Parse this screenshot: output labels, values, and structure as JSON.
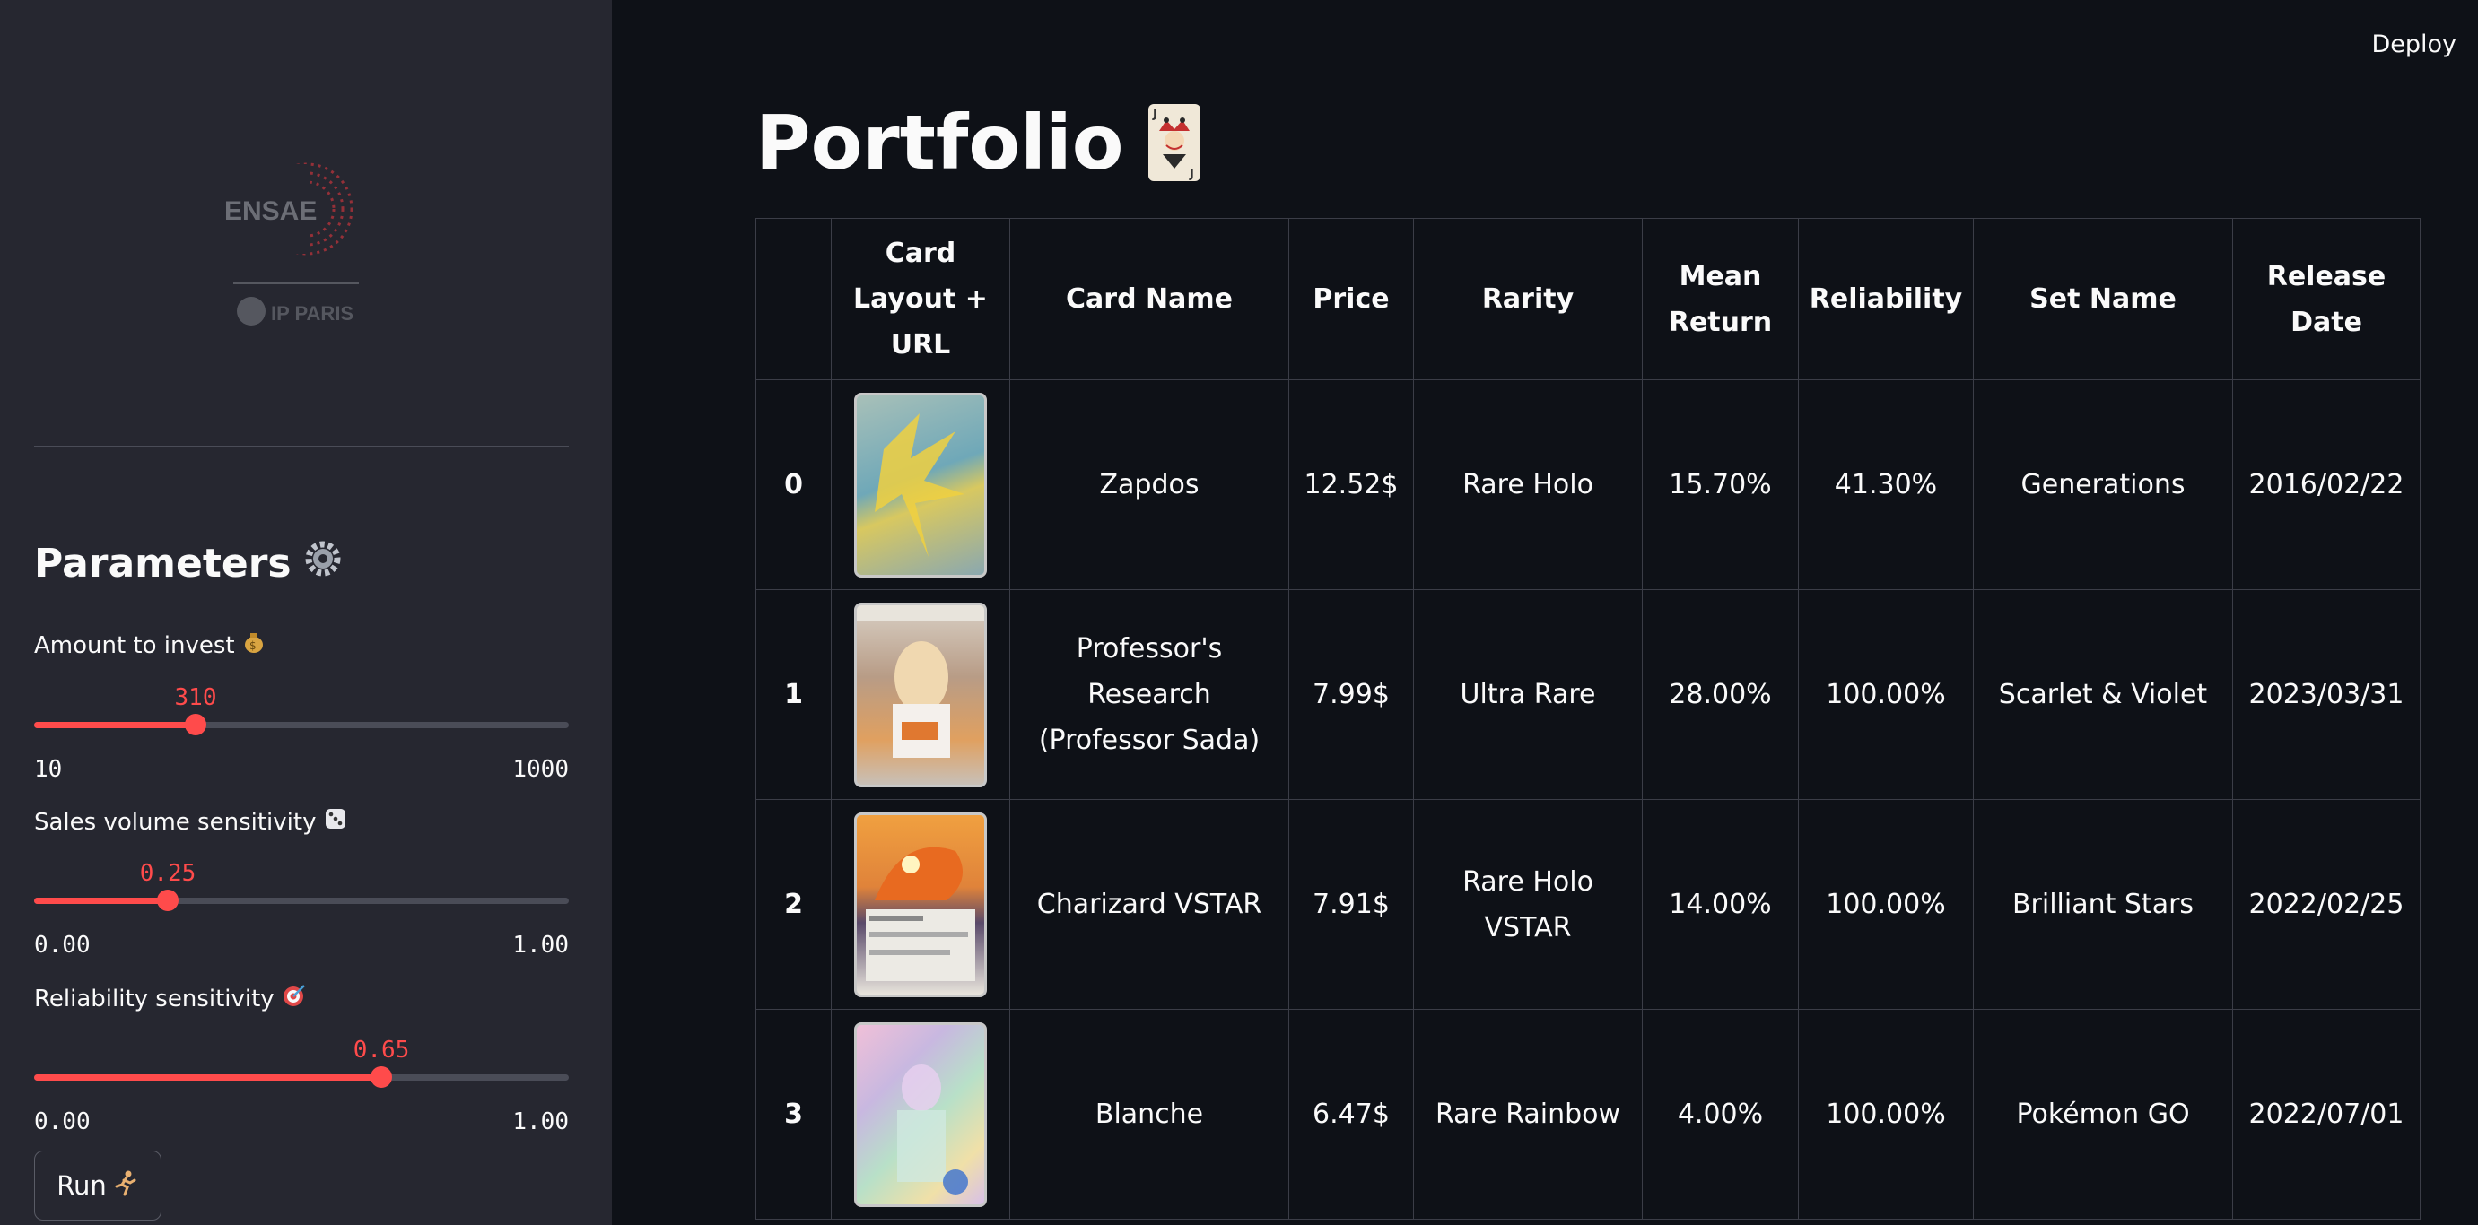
{
  "header": {
    "deploy_label": "Deploy"
  },
  "sidebar": {
    "logo": {
      "text_top": "ENSAE",
      "text_bottom": "IP PARIS"
    },
    "params_title": "Parameters",
    "params_icon": "gear-icon",
    "sliders": [
      {
        "label": "Amount to invest",
        "icon": "money-bag-icon",
        "value_text": "310",
        "min_text": "10",
        "max_text": "1000",
        "fraction": 0.303
      },
      {
        "label": "Sales volume sensitivity",
        "icon": "dice-icon",
        "value_text": "0.25",
        "min_text": "0.00",
        "max_text": "1.00",
        "fraction": 0.25
      },
      {
        "label": "Reliability sensitivity",
        "icon": "target-icon",
        "value_text": "0.65",
        "min_text": "0.00",
        "max_text": "1.00",
        "fraction": 0.65
      }
    ],
    "run_label": "Run",
    "run_icon": "runner-icon"
  },
  "main": {
    "title": "Portfolio",
    "title_icon": "joker-card-icon",
    "table": {
      "headers": [
        "",
        "Card Layout + URL",
        "Card Name",
        "Price",
        "Rarity",
        "Mean Return",
        "Reliability",
        "Set Name",
        "Release Date"
      ],
      "rows": [
        {
          "index": "0",
          "card_name": "Zapdos",
          "price": "12.52$",
          "rarity": "Rare Holo",
          "mean_return": "15.70%",
          "reliability": "41.30%",
          "set_name": "Generations",
          "release_date": "2016/02/22",
          "card_color": "#6fa8b8"
        },
        {
          "index": "1",
          "card_name": "Professor's Research (Professor Sada)",
          "price": "7.99$",
          "rarity": "Ultra Rare",
          "mean_return": "28.00%",
          "reliability": "100.00%",
          "set_name": "Scarlet & Violet",
          "release_date": "2023/03/31",
          "card_color": "#b89c86"
        },
        {
          "index": "2",
          "card_name": "Charizard VSTAR",
          "price": "7.91$",
          "rarity": "Rare Holo VSTAR",
          "mean_return": "14.00%",
          "reliability": "100.00%",
          "set_name": "Brilliant Stars",
          "release_date": "2022/02/25",
          "card_color": "#e0833a"
        },
        {
          "index": "3",
          "card_name": "Blanche",
          "price": "6.47$",
          "rarity": "Rare Rainbow",
          "mean_return": "4.00%",
          "reliability": "100.00%",
          "set_name": "Pokémon GO",
          "release_date": "2022/07/01",
          "card_color": "#c8b8e0"
        }
      ]
    }
  },
  "colors": {
    "accent": "#ff4b4b",
    "sidebar_bg": "#262730",
    "main_bg": "#0e1117"
  }
}
